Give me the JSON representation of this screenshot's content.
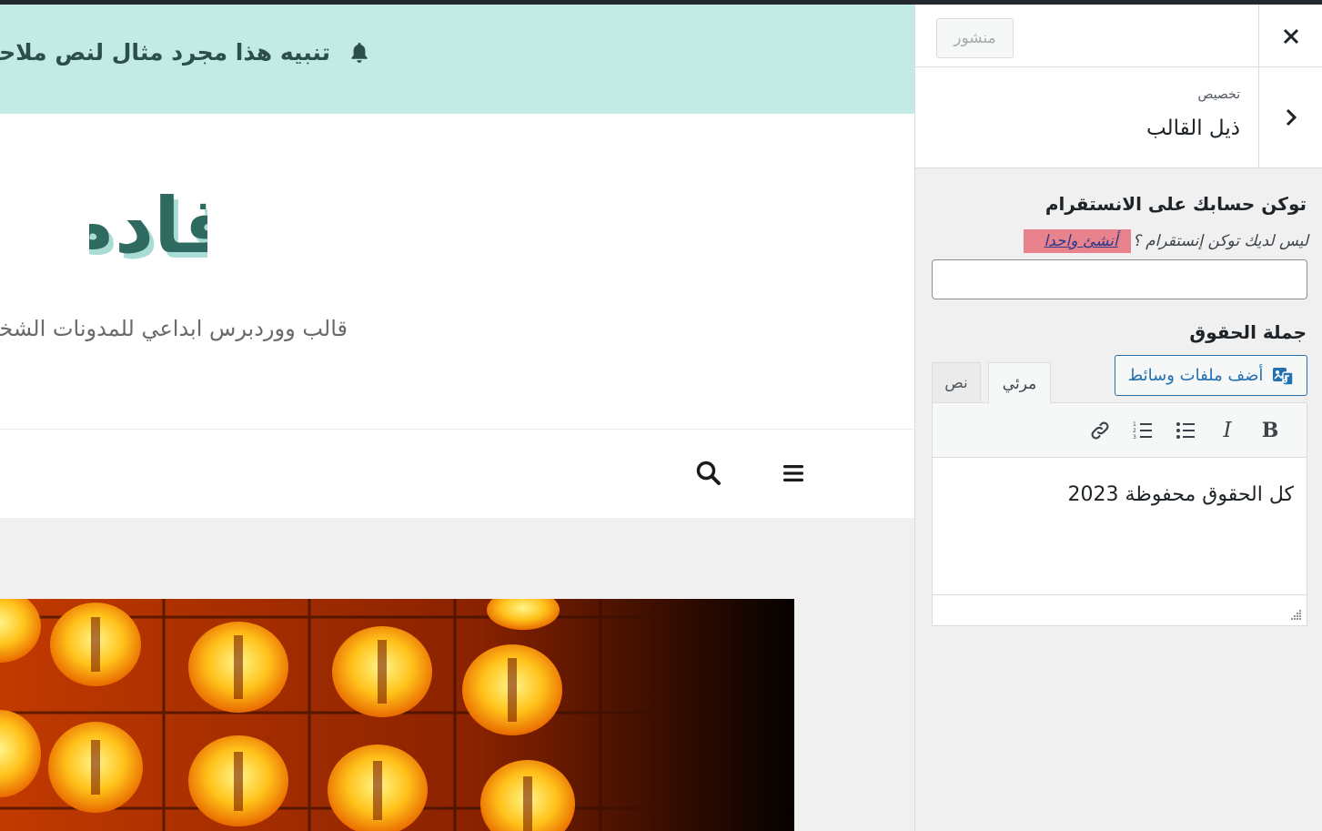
{
  "preview": {
    "notice_text": "تنبيه هذا مجرد مثال لنص ملاحظة",
    "notice_icon": "bell-icon",
    "site_logo_text": "قادم",
    "tagline": "قالب ووردبرس ابداعي للمدونات الشخصية",
    "nav_icons": [
      "search-icon",
      "menu-icon"
    ],
    "hero_image": "orange-chinese-lanterns-photo"
  },
  "customizer": {
    "close_icon": "close-icon",
    "publish_label": "منشور",
    "back_icon": "chevron-right-icon",
    "section_context": "تخصيص",
    "section_title": "ذيل القالب",
    "instagram": {
      "label": "توكن حسابك على الانستقرام",
      "description": "ليس لديك توكن إنستقرام ؟",
      "link_text": "أنشئ واحدا",
      "value": ""
    },
    "copyright": {
      "label": "جملة الحقوق",
      "add_media_label": "أضف ملفات وسائط",
      "tab_visual": "مرئي",
      "tab_text": "نص",
      "toolbar": [
        "bold",
        "italic",
        "bulleted-list",
        "numbered-list",
        "link"
      ],
      "toolbar_bold": "B",
      "toolbar_italic": "I",
      "content": "كل الحقوق محفوظة 2023"
    }
  },
  "colors": {
    "notice_bg": "#c3ebe6",
    "accent": "#2271b1",
    "link_highlight": "#e8838d",
    "logo_green": "#2e6a5f"
  }
}
